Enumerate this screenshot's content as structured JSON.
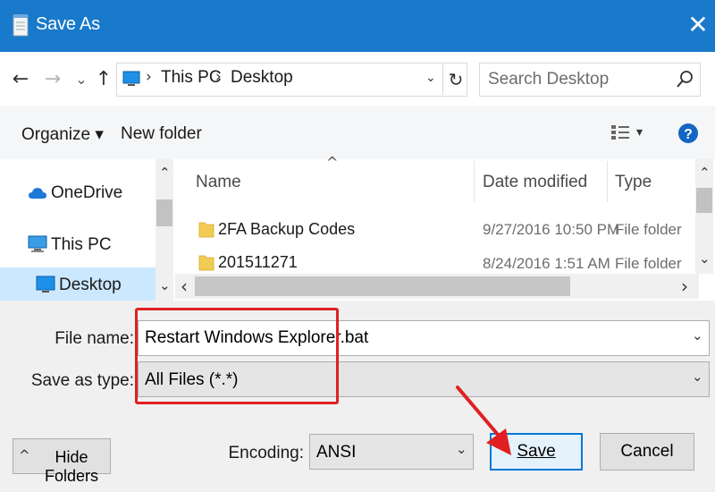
{
  "window": {
    "title": "Save As",
    "close_glyph": "✕"
  },
  "nav": {
    "back_glyph": "←",
    "forward_glyph": "→",
    "recent_glyph": "⌄",
    "up_glyph": "↑"
  },
  "address": {
    "crumbs": [
      "This PC",
      "Desktop"
    ],
    "separator": "›",
    "refresh_glyph": "↻"
  },
  "search": {
    "placeholder": "Search Desktop"
  },
  "commands": {
    "organize": "Organize ▾",
    "new_folder": "New folder",
    "view_caret": "▾"
  },
  "sidebar": {
    "items": [
      {
        "label": "OneDrive",
        "icon": "cloud-icon"
      },
      {
        "label": "This PC",
        "icon": "computer-icon"
      },
      {
        "label": "Desktop",
        "icon": "desktop-icon",
        "selected": true
      }
    ],
    "scroll_up": "⌃",
    "scroll_down": "⌄"
  },
  "file_list": {
    "sort_indicator": "^",
    "columns": [
      "Name",
      "Date modified",
      "Type"
    ],
    "rows": [
      {
        "name": "2FA Backup Codes",
        "date": "9/27/2016 10:50 PM",
        "type": "File folder"
      },
      {
        "name": "201511271",
        "date": "8/24/2016 1:51 AM",
        "type": "File folder"
      }
    ],
    "scroll_left": "‹",
    "scroll_right": "›",
    "scroll_up": "⌃",
    "scroll_down": "⌄"
  },
  "form": {
    "file_name_label": "File name:",
    "file_name_value": "Restart Windows Explorer.bat",
    "save_type_label": "Save as type:",
    "save_type_value": "All Files  (*.*)",
    "encoding_label": "Encoding:",
    "encoding_value": "ANSI",
    "dropdown_glyph": "⌄"
  },
  "buttons": {
    "hide_folders": "Hide Folders",
    "hide_glyph": "^",
    "save": "Save",
    "cancel": "Cancel"
  },
  "colors": {
    "titlebar": "#1979ca",
    "selection": "#cce8ff",
    "annotation": "#e02020",
    "primary_border": "#0078d7"
  }
}
